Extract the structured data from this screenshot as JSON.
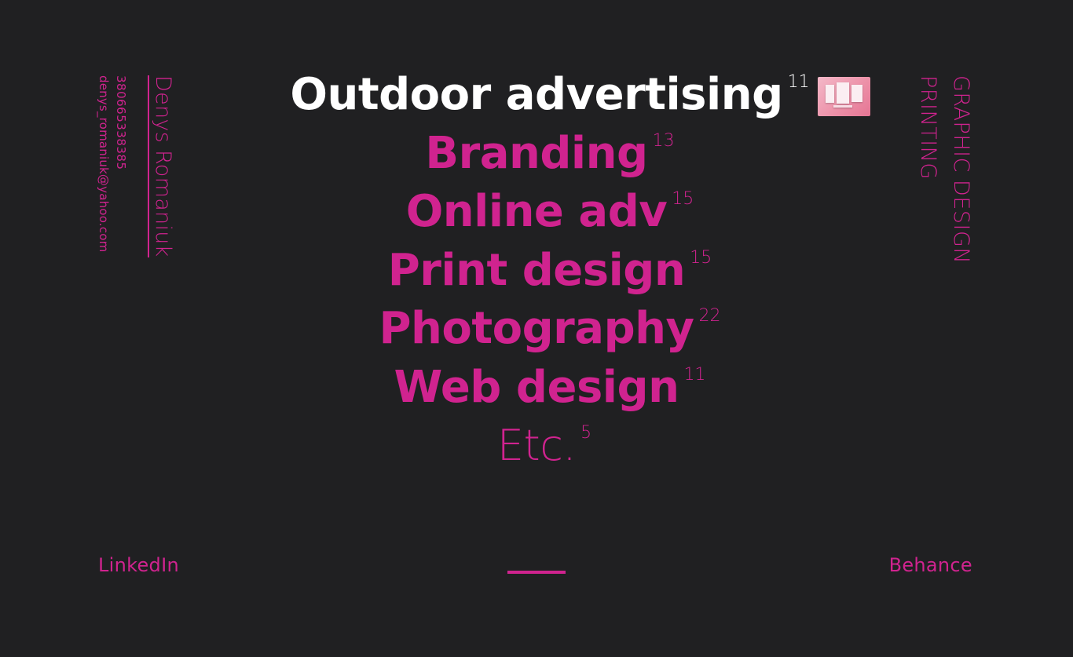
{
  "contact": {
    "name": "Denys Romaniuk",
    "phone": "380665338385",
    "email": "denys_romaniuk@yahoo.com"
  },
  "side_labels": {
    "graphic_design": "GRAPHIC DESIGN",
    "printing": "PRINTING"
  },
  "menu": {
    "items": [
      {
        "label": "Outdoor advertising",
        "count": "11",
        "active": true
      },
      {
        "label": "Branding",
        "count": "13"
      },
      {
        "label": "Online adv",
        "count": "15"
      },
      {
        "label": "Print design",
        "count": "15"
      },
      {
        "label": "Photography",
        "count": "22"
      },
      {
        "label": "Web design",
        "count": "11"
      },
      {
        "label": "Etc.",
        "count": "5"
      }
    ]
  },
  "links": {
    "linkedin": "LinkedIn",
    "behance": "Behance"
  },
  "colors": {
    "background": "#202022",
    "accent": "#d0238f",
    "active": "#ffffff"
  },
  "icons": {
    "thumbnail": "outdoor-advertising-preview-thumbnail"
  }
}
